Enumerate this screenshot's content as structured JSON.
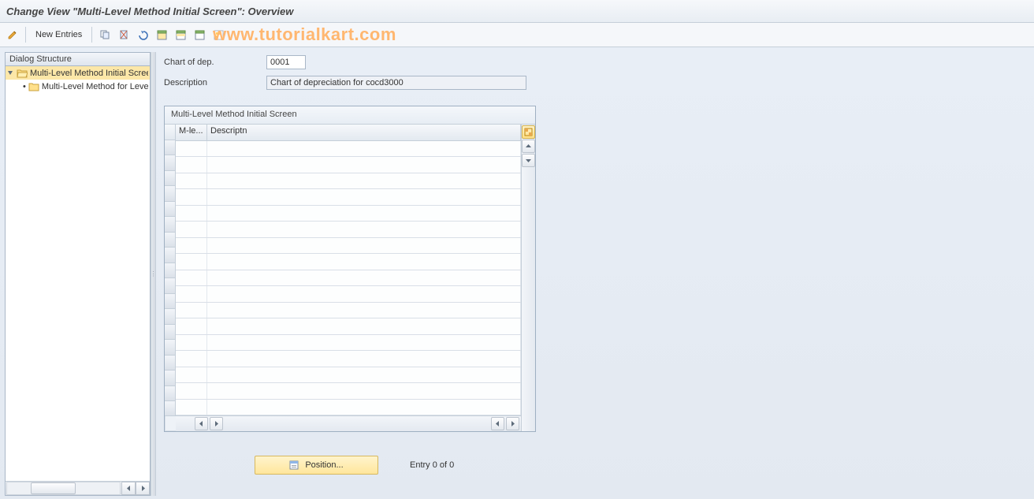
{
  "title": "Change View \"Multi-Level Method Initial Screen\": Overview",
  "watermark": "www.tutorialkart.com",
  "toolbar": {
    "new_entries_label": "New Entries"
  },
  "sidebar": {
    "header": "Dialog Structure",
    "items": [
      {
        "label": "Multi-Level Method Initial Screen",
        "selected": true,
        "level": 0
      },
      {
        "label": "Multi-Level Method for Levels",
        "selected": false,
        "level": 1
      }
    ]
  },
  "form": {
    "chart_of_dep_label": "Chart of dep.",
    "chart_of_dep_value": "0001",
    "description_label": "Description",
    "description_value": "Chart of depreciation for cocd3000"
  },
  "table": {
    "title": "Multi-Level Method Initial Screen",
    "columns": {
      "mlevel": "M-le...",
      "descriptn": "Descriptn"
    },
    "row_count": 17
  },
  "footer": {
    "position_label": "Position...",
    "entry_text": "Entry 0 of 0"
  }
}
